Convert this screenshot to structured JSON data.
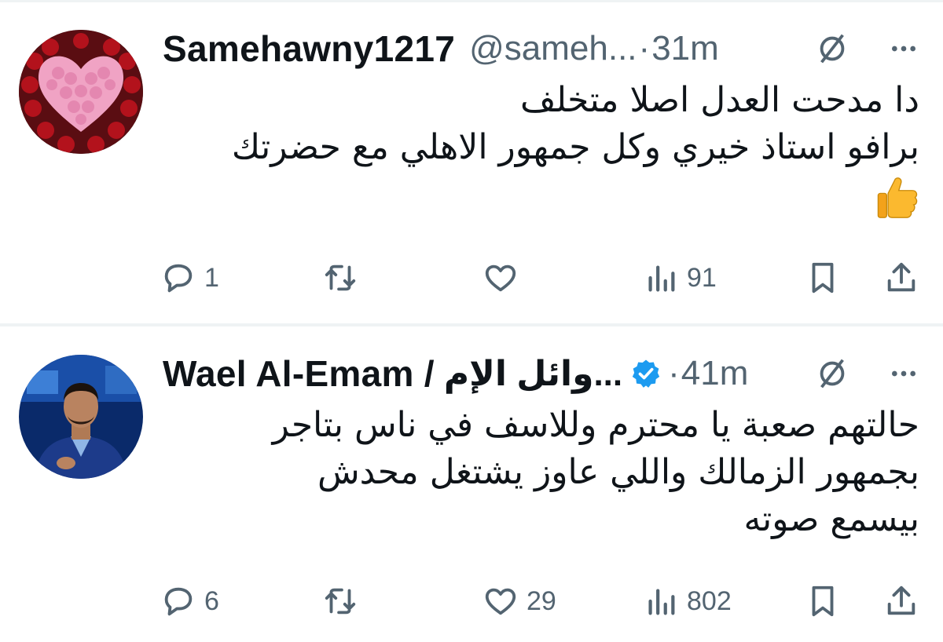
{
  "tweets": [
    {
      "name": "Samehawny1217",
      "name_ar": "",
      "handle": "@sameh...",
      "dot": "·",
      "time": "31m",
      "verified": false,
      "lines": [
        "دا مدحت العدل اصلا متخلف",
        "برافو استاذ خيري وكل جمهور الاهلي مع حضرتك"
      ],
      "emoji": "thumbs-up",
      "replies": "1",
      "reposts": "",
      "likes": "",
      "views": "91"
    },
    {
      "name": "Wael Al-Emam / ",
      "name_ar": "وائل الإم...",
      "handle": "",
      "dot": "·",
      "time": "41m",
      "verified": true,
      "lines": [
        "حالتهم صعبة يا محترم وللاسف في ناس بتاجر",
        "بجمهور الزمالك  واللي عاوز يشتغل محدش",
        "بيسمع صوته"
      ],
      "emoji": "",
      "replies": "6",
      "reposts": "",
      "likes": "29",
      "views": "802"
    }
  ],
  "colors": {
    "secondary": "#536471",
    "verified": "#1d9bf0",
    "divider": "#eff3f4"
  },
  "icons": [
    "reply-icon",
    "repost-icon",
    "like-icon",
    "views-icon",
    "bookmark-icon",
    "share-icon",
    "grok-icon",
    "more-icon",
    "verified-badge-icon"
  ]
}
